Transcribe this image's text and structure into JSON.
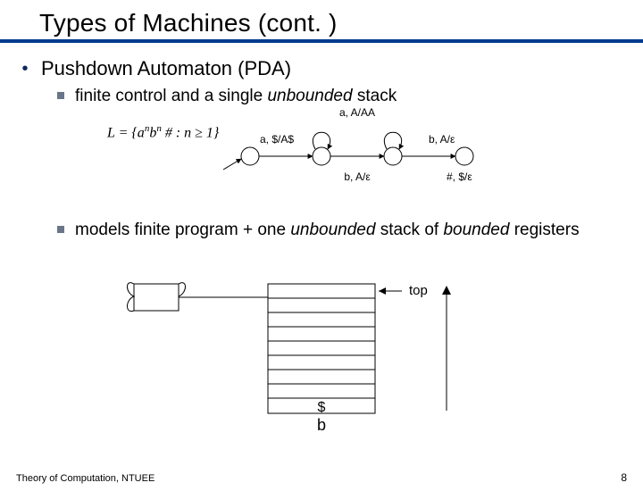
{
  "slide": {
    "title": "Types of Machines (cont. )",
    "footer": "Theory of Computation, NTUEE",
    "page_number": "8"
  },
  "content": {
    "lvl1_bullet": "•",
    "lvl1_text": "Pushdown Automaton (PDA)",
    "sub1_pre": "finite control and a single ",
    "sub1_italic": "unbounded",
    "sub1_post": " stack",
    "sub2_pre": "models finite program + one ",
    "sub2_italic1": "unbounded",
    "sub2_mid": " stack of ",
    "sub2_italic2": "bounded",
    "sub2_post": " registers"
  },
  "formula": {
    "L_eq": "L = {a",
    "exp_n1": "n",
    "b": "b",
    "exp_n2": "n",
    "hash": " # : ",
    "cond": "n ≥ 1}"
  },
  "pda_labels": {
    "a_AAA": "a, A/AA",
    "a_dollarA": "a, $/A$",
    "b_Aeps_top": "b, A/ε",
    "b_Aeps_bot": "b, A/ε",
    "hash_dollar": "#, $/ε"
  },
  "stack": {
    "top_label": "top",
    "bottom_dollar": "$",
    "bottom_b": "b"
  }
}
